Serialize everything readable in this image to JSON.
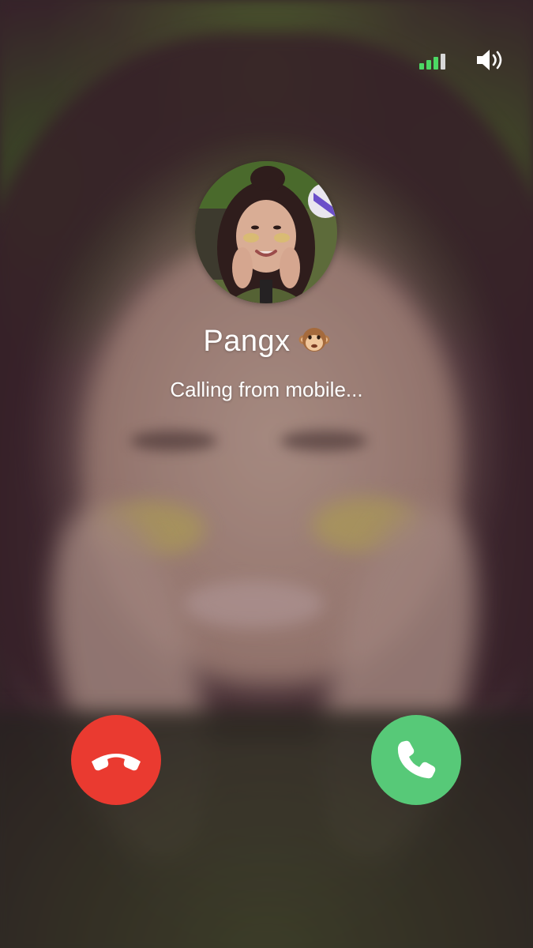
{
  "status_bar": {
    "signal_strength": 3,
    "signal_max": 4,
    "signal_active_color": "#4cd964",
    "signal_inactive_color": "#d8d8d8",
    "speaker_icon": "speaker-volume-icon"
  },
  "caller": {
    "name": "Pangx",
    "emoji": "monkey-face-icon",
    "status": "Calling from mobile...",
    "avatar": "caller-avatar-photo"
  },
  "actions": {
    "decline": {
      "icon": "phone-hangup-icon",
      "color": "#ea3a30"
    },
    "accept": {
      "icon": "phone-icon",
      "color": "#57c978"
    }
  }
}
